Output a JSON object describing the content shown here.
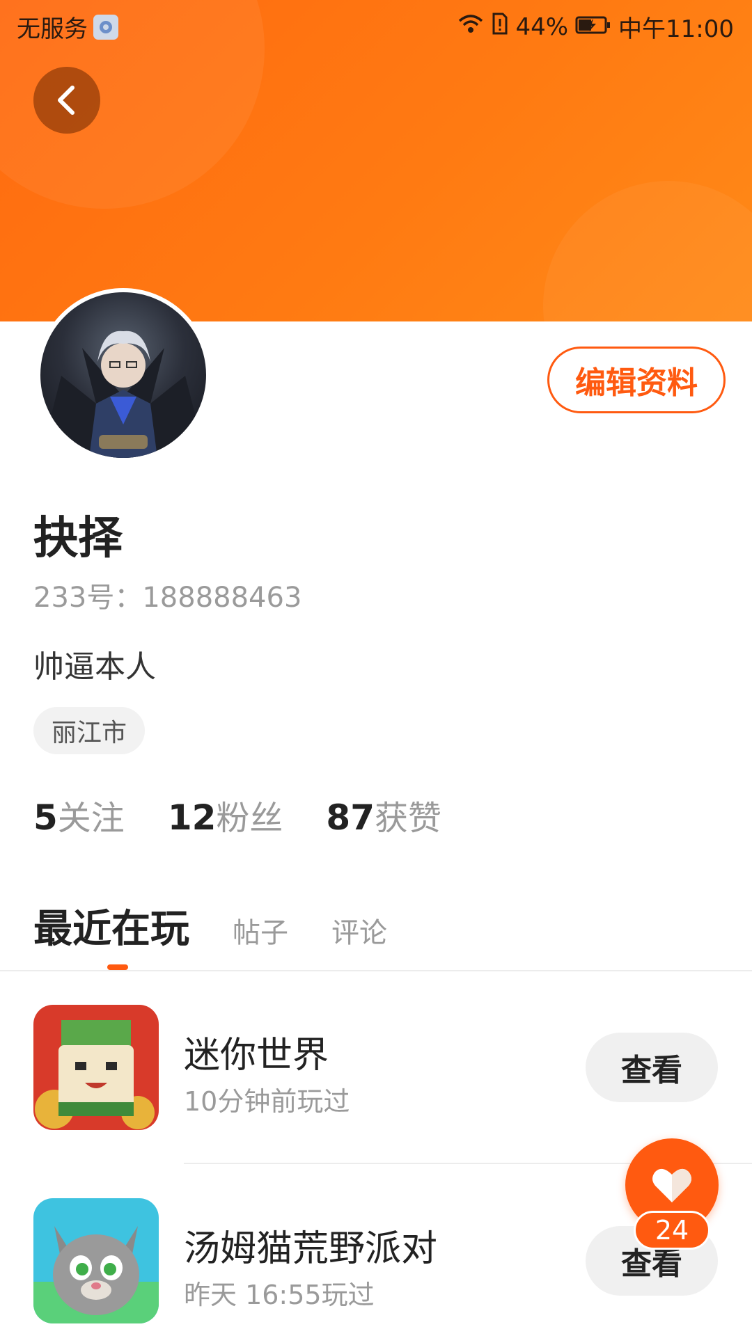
{
  "status_bar": {
    "carrier": "无服务",
    "battery_percent": "44%",
    "time": "中午11:00"
  },
  "header": {
    "back_icon": "chevron-left-icon"
  },
  "profile": {
    "edit_button": "编辑资料",
    "username": "抉择",
    "account_id": "233号：188888463",
    "bio": "帅逼本人",
    "location": "丽江市"
  },
  "stats": [
    {
      "value": "5",
      "label": "关注"
    },
    {
      "value": "12",
      "label": "粉丝"
    },
    {
      "value": "87",
      "label": "获赞"
    }
  ],
  "tabs": [
    {
      "label": "最近在玩",
      "active": true
    },
    {
      "label": "帖子",
      "active": false
    },
    {
      "label": "评论",
      "active": false
    }
  ],
  "games": [
    {
      "title": "迷你世界",
      "subtitle": "10分钟前玩过",
      "action": "查看"
    },
    {
      "title": "汤姆猫荒野派对",
      "subtitle": "昨天 16:55玩过",
      "action": "查看"
    }
  ],
  "like_fab": {
    "count": "24",
    "icon": "heart-icon"
  },
  "colors": {
    "accent": "#ff5a10",
    "banner": "#ff7a12"
  }
}
